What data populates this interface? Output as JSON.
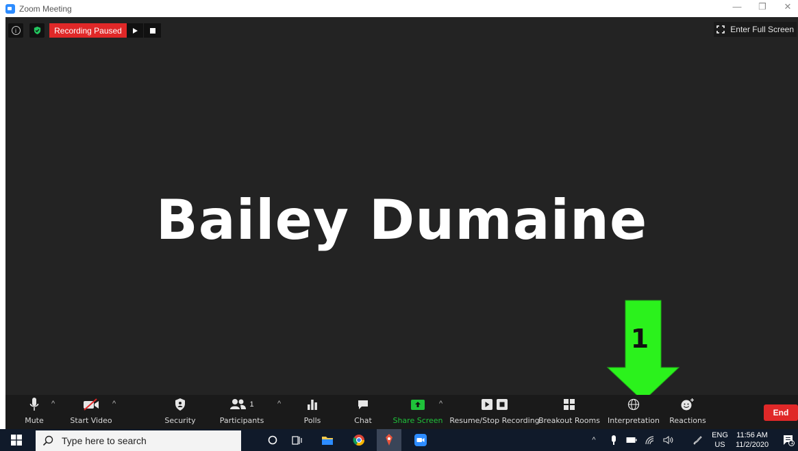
{
  "window": {
    "title": "Zoom Meeting",
    "controls": [
      "—",
      "❐",
      "✕"
    ]
  },
  "meeting": {
    "participant_name": "Bailey Dumaine",
    "recording_status": "Recording Paused",
    "fullscreen_label": "Enter Full Screen",
    "annotation_number": "1"
  },
  "toolbar": {
    "mute": "Mute",
    "start_video": "Start Video",
    "security": "Security",
    "participants": "Participants",
    "participants_count": "1",
    "polls": "Polls",
    "chat": "Chat",
    "share_screen": "Share Screen",
    "resume_stop_recording": "Resume/Stop Recording",
    "breakout_rooms": "Breakout Rooms",
    "interpretation": "Interpretation",
    "reactions": "Reactions",
    "end": "End"
  },
  "taskbar": {
    "search_placeholder": "Type here to search",
    "lang_top": "ENG",
    "lang_bottom": "US",
    "time": "11:56 AM",
    "date": "11/2/2020",
    "notification_count": "1"
  },
  "colors": {
    "meeting_bg": "#232323",
    "toolbar_bg": "#1a1a1a",
    "record_red": "#E02828",
    "share_green": "#1FC23A",
    "arrow_green": "#2BF21C",
    "zoom_blue": "#2D8CFF"
  }
}
